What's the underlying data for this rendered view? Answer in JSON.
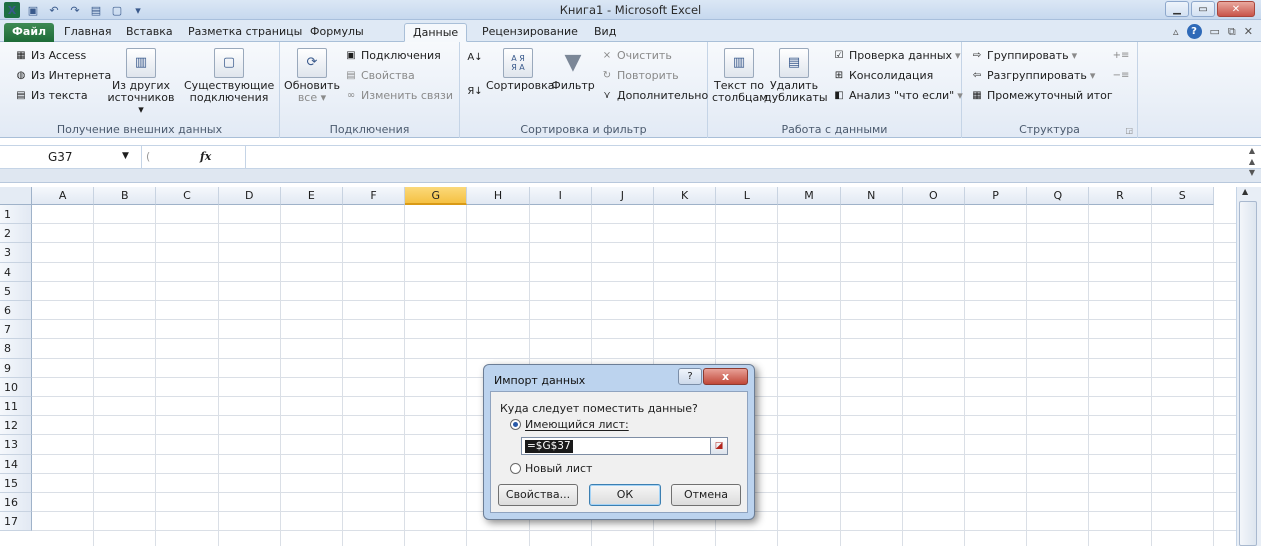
{
  "window": {
    "title": "Книга1 - Microsoft Excel",
    "logo_text": "X"
  },
  "tabs": [
    {
      "label": "Файл"
    },
    {
      "label": "Главная"
    },
    {
      "label": "Вставка"
    },
    {
      "label": "Разметка страницы"
    },
    {
      "label": "Формулы"
    },
    {
      "label": "Данные"
    },
    {
      "label": "Рецензирование"
    },
    {
      "label": "Вид"
    }
  ],
  "active_tab": "Данные",
  "ribbon": {
    "external": {
      "from_access": "Из Access",
      "from_web": "Из Интернета",
      "from_text": "Из текста",
      "other_sources_1": "Из других",
      "other_sources_2": "источников",
      "existing_1": "Существующие",
      "existing_2": "подключения",
      "label": "Получение внешних данных"
    },
    "connections": {
      "refresh_1": "Обновить",
      "refresh_2": "все",
      "connections": "Подключения",
      "properties": "Свойства",
      "edit_links": "Изменить связи",
      "label": "Подключения"
    },
    "sort": {
      "sort": "Сортировка",
      "filter": "Фильтр",
      "clear": "Очистить",
      "reapply": "Повторить",
      "advanced": "Дополнительно",
      "az": "А Я",
      "za": "Я А",
      "label": "Сортировка и фильтр"
    },
    "tools": {
      "text_to_cols_1": "Текст по",
      "text_to_cols_2": "столбцам",
      "remove_dups_1": "Удалить",
      "remove_dups_2": "дубликаты",
      "validation": "Проверка данных",
      "consolidate": "Консолидация",
      "whatif": "Анализ \"что если\"",
      "label": "Работа с данными"
    },
    "outline": {
      "group": "Группировать",
      "ungroup": "Разгруппировать",
      "subtotal": "Промежуточный итог",
      "label": "Структура"
    }
  },
  "formula_bar": {
    "name_box": "G37",
    "fx": "fx",
    "formula": ""
  },
  "columns": [
    "A",
    "B",
    "C",
    "D",
    "E",
    "F",
    "G",
    "H",
    "I",
    "J",
    "K",
    "L",
    "M",
    "N",
    "O",
    "P",
    "Q",
    "R",
    "S"
  ],
  "selected_column": "G",
  "rows": [
    "1",
    "2",
    "3",
    "4",
    "5",
    "6",
    "7",
    "8",
    "9",
    "10",
    "11",
    "12",
    "13",
    "14",
    "15",
    "16",
    "17"
  ],
  "dialog": {
    "title": "Импорт данных",
    "help": "?",
    "close": "x",
    "question": "Куда следует поместить данные?",
    "existing_sheet": "Имеющийся лист:",
    "reference": "=$G$37",
    "new_sheet": "Новый лист",
    "properties_btn": "Свойства...",
    "ok_btn": "ОК",
    "cancel_btn": "Отмена"
  }
}
